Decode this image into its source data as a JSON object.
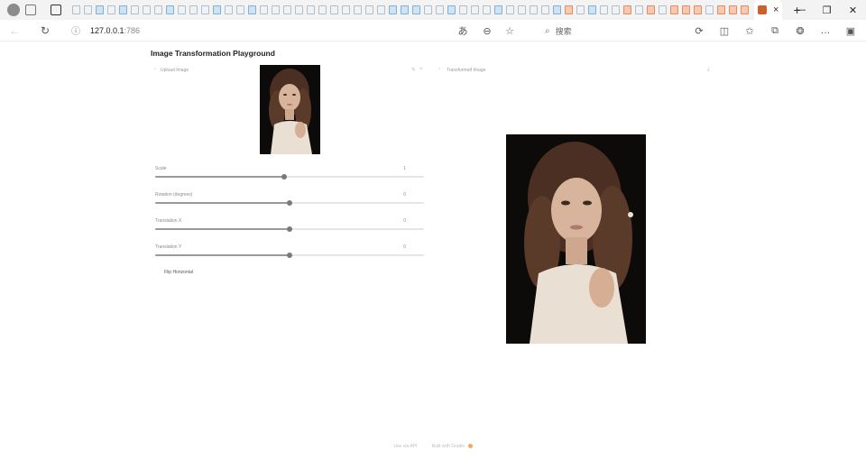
{
  "browser": {
    "url_host": "127.0.0.1",
    "url_port": ":786",
    "search_placeholder": "搜索",
    "tab_close": "×",
    "new_tab": "+",
    "win_min": "—",
    "win_max": "❐",
    "win_close": "✕"
  },
  "app": {
    "title": "Image Transformation Playground",
    "upload_label": "Upload Image",
    "output_label": "Transformed Image"
  },
  "sliders": [
    {
      "label": "Scale",
      "value": "1",
      "fraction": 0.48
    },
    {
      "label": "Rotation (degrees)",
      "value": "0",
      "fraction": 0.5
    },
    {
      "label": "Translation X",
      "value": "0",
      "fraction": 0.5
    },
    {
      "label": "Translation Y",
      "value": "0",
      "fraction": 0.5
    }
  ],
  "flip_label": "Flip Horizontal",
  "footer": {
    "api_text": "Use via API",
    "built_text": "Built with Gradio"
  },
  "colors": {
    "accent": "#9a9a9a",
    "photo_bg": "#0d0b0a",
    "hair": "#4a2f22",
    "skin": "#d9b49d",
    "dress": "#e9e0d3"
  }
}
